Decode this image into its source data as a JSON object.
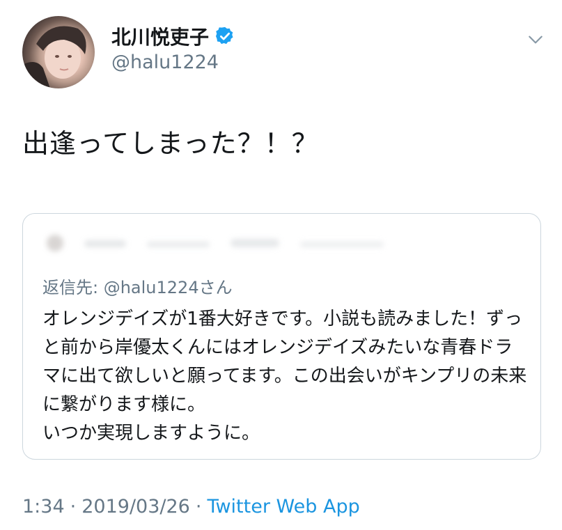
{
  "header": {
    "display_name": "北川悦吏子",
    "handle": "@halu1224",
    "verified": true,
    "avatar_icon": "user-avatar",
    "menu_icon": "chevron-down-icon"
  },
  "tweet": {
    "text": "出逢ってしまった？！？"
  },
  "quote": {
    "reply_to": "返信先: @halu1224さん",
    "text": "オレンジデイズが1番大好きです。小説も読みました！ずっと前から岸優太くんにはオレンジデイズみたいな青春ドラマに出て欲しいと願ってます。この出会いがキンプリの未来に繋がります様に。\nいつか実現しますように。"
  },
  "meta": {
    "time": "1:34",
    "separator": "·",
    "date": "2019/03/26",
    "source": "Twitter Web App"
  },
  "colors": {
    "text": "#14171a",
    "secondary": "#657786",
    "link": "#1b95e0",
    "border": "#ccd6dd",
    "verified": "#1da1f2"
  }
}
